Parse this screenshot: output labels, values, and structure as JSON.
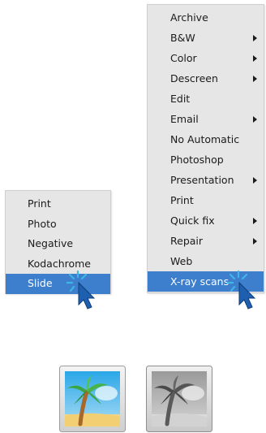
{
  "left_menu": {
    "items": [
      {
        "label": "Print"
      },
      {
        "label": "Photo"
      },
      {
        "label": "Negative"
      },
      {
        "label": "Kodachrome"
      },
      {
        "label": "Slide",
        "selected": true
      }
    ]
  },
  "right_menu": {
    "items": [
      {
        "label": "Archive",
        "submenu": false
      },
      {
        "label": "B&W",
        "submenu": true
      },
      {
        "label": "Color",
        "submenu": true
      },
      {
        "label": "Descreen",
        "submenu": true
      },
      {
        "label": "Edit",
        "submenu": false
      },
      {
        "label": "Email",
        "submenu": true
      },
      {
        "label": "No Automatic",
        "submenu": false
      },
      {
        "label": "Photoshop",
        "submenu": false
      },
      {
        "label": "Presentation",
        "submenu": true
      },
      {
        "label": "Print",
        "submenu": false
      },
      {
        "label": "Quick fix",
        "submenu": true
      },
      {
        "label": "Repair",
        "submenu": true
      },
      {
        "label": "Web",
        "submenu": false
      },
      {
        "label": "X-ray scans",
        "submenu": false,
        "selected": true
      }
    ]
  },
  "colors": {
    "menu_bg": "#e6e6e6",
    "selection": "#3d7fcc",
    "cursor": "#1f5fb0",
    "click_rays": "#3fb6e8"
  },
  "icons": [
    "pointer-click-icon",
    "color-photo-icon",
    "grayscale-photo-icon"
  ]
}
